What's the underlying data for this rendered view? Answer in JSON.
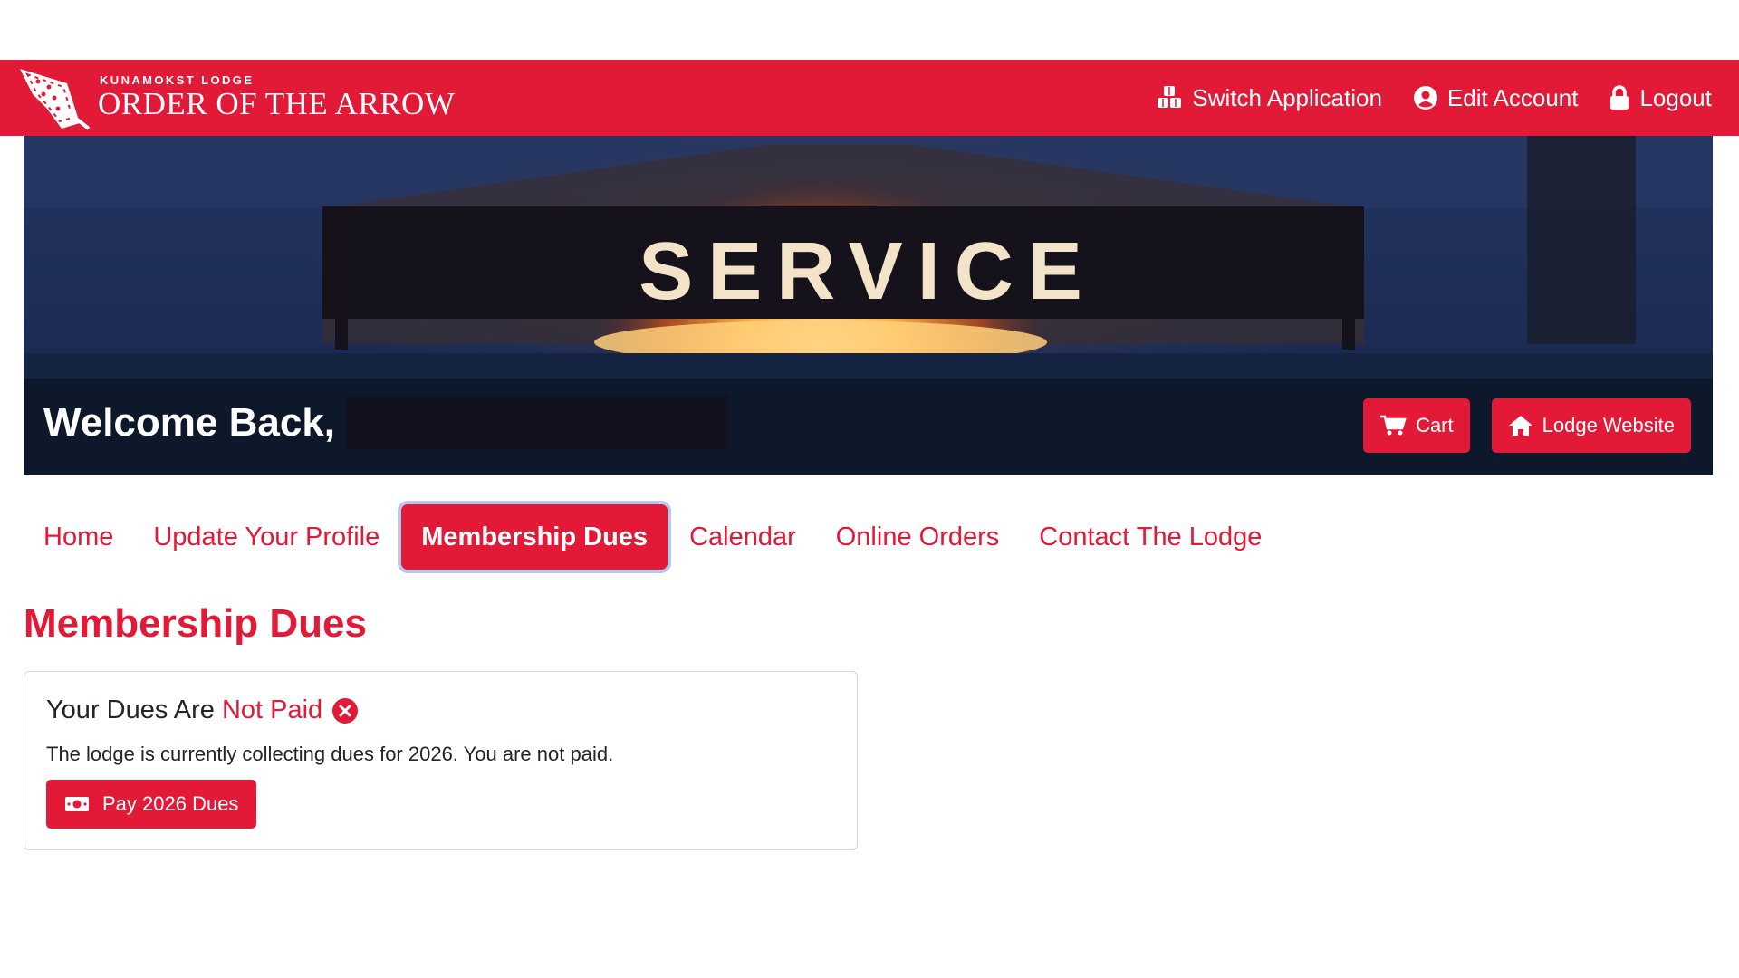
{
  "header": {
    "brand_small": "KUNAMOKST LODGE",
    "brand_large": "ORDER OF THE ARROW",
    "logo_icon": "arrowhead-logo-icon",
    "nav": [
      {
        "label": "Switch Application",
        "icon": "cubes-icon"
      },
      {
        "label": "Edit Account",
        "icon": "user-circle-icon"
      },
      {
        "label": "Logout",
        "icon": "lock-icon"
      }
    ]
  },
  "hero": {
    "sign_text": "SERVICE",
    "welcome": "Welcome Back,",
    "buttons": [
      {
        "label": "Cart",
        "icon": "cart-icon"
      },
      {
        "label": "Lodge Website",
        "icon": "home-icon"
      }
    ]
  },
  "tabs": [
    {
      "label": "Home",
      "active": false
    },
    {
      "label": "Update Your Profile",
      "active": false
    },
    {
      "label": "Membership Dues",
      "active": true
    },
    {
      "label": "Calendar",
      "active": false
    },
    {
      "label": "Online Orders",
      "active": false
    },
    {
      "label": "Contact The Lodge",
      "active": false
    }
  ],
  "page_title": "Membership Dues",
  "dues_card": {
    "heading_prefix": "Your Dues Are",
    "heading_status": "Not Paid",
    "status_icon": "x-circle-icon",
    "message": "The lodge is currently collecting dues for 2026. You are not paid.",
    "pay_button": "Pay 2026 Dues",
    "pay_icon": "money-bill-icon"
  },
  "colors": {
    "primary": "#e21a38",
    "active_ring": "#b9c7ef",
    "card_border": "#d6d8db"
  }
}
